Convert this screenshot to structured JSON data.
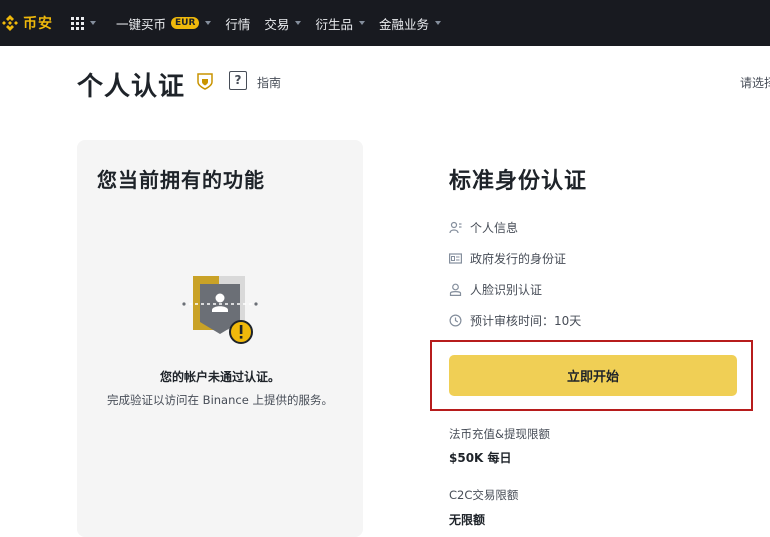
{
  "nav": {
    "logo_text": "币安",
    "items": [
      {
        "label": "一键买币",
        "badge": "EUR"
      },
      {
        "label": "行情"
      },
      {
        "label": "交易"
      },
      {
        "label": "衍生品"
      },
      {
        "label": "金融业务"
      }
    ]
  },
  "header": {
    "title": "个人认证",
    "guide_label": "指南",
    "select_label": "请选择"
  },
  "left_card": {
    "title": "您当前拥有的功能",
    "status_title": "您的帐户未通过认证。",
    "status_desc": "完成验证以访问在 Binance 上提供的服务。"
  },
  "right_panel": {
    "title": "标准身份认证",
    "requirements": [
      {
        "icon": "person-info-icon",
        "label": "个人信息"
      },
      {
        "icon": "id-card-icon",
        "label": "政府发行的身份证"
      },
      {
        "icon": "face-id-icon",
        "label": "人脸识别认证"
      },
      {
        "icon": "clock-icon",
        "label": "预计审核时间：10天"
      }
    ],
    "start_button": "立即开始",
    "limits": [
      {
        "label": "法币充值&提现限额",
        "value": "$50K 每日"
      },
      {
        "label": "C2C交易限额",
        "value": "无限额"
      }
    ]
  },
  "colors": {
    "nav_bg": "#181a20",
    "brand": "#f0b90b",
    "button": "#f0cf55",
    "highlight": "#b71c1c"
  }
}
